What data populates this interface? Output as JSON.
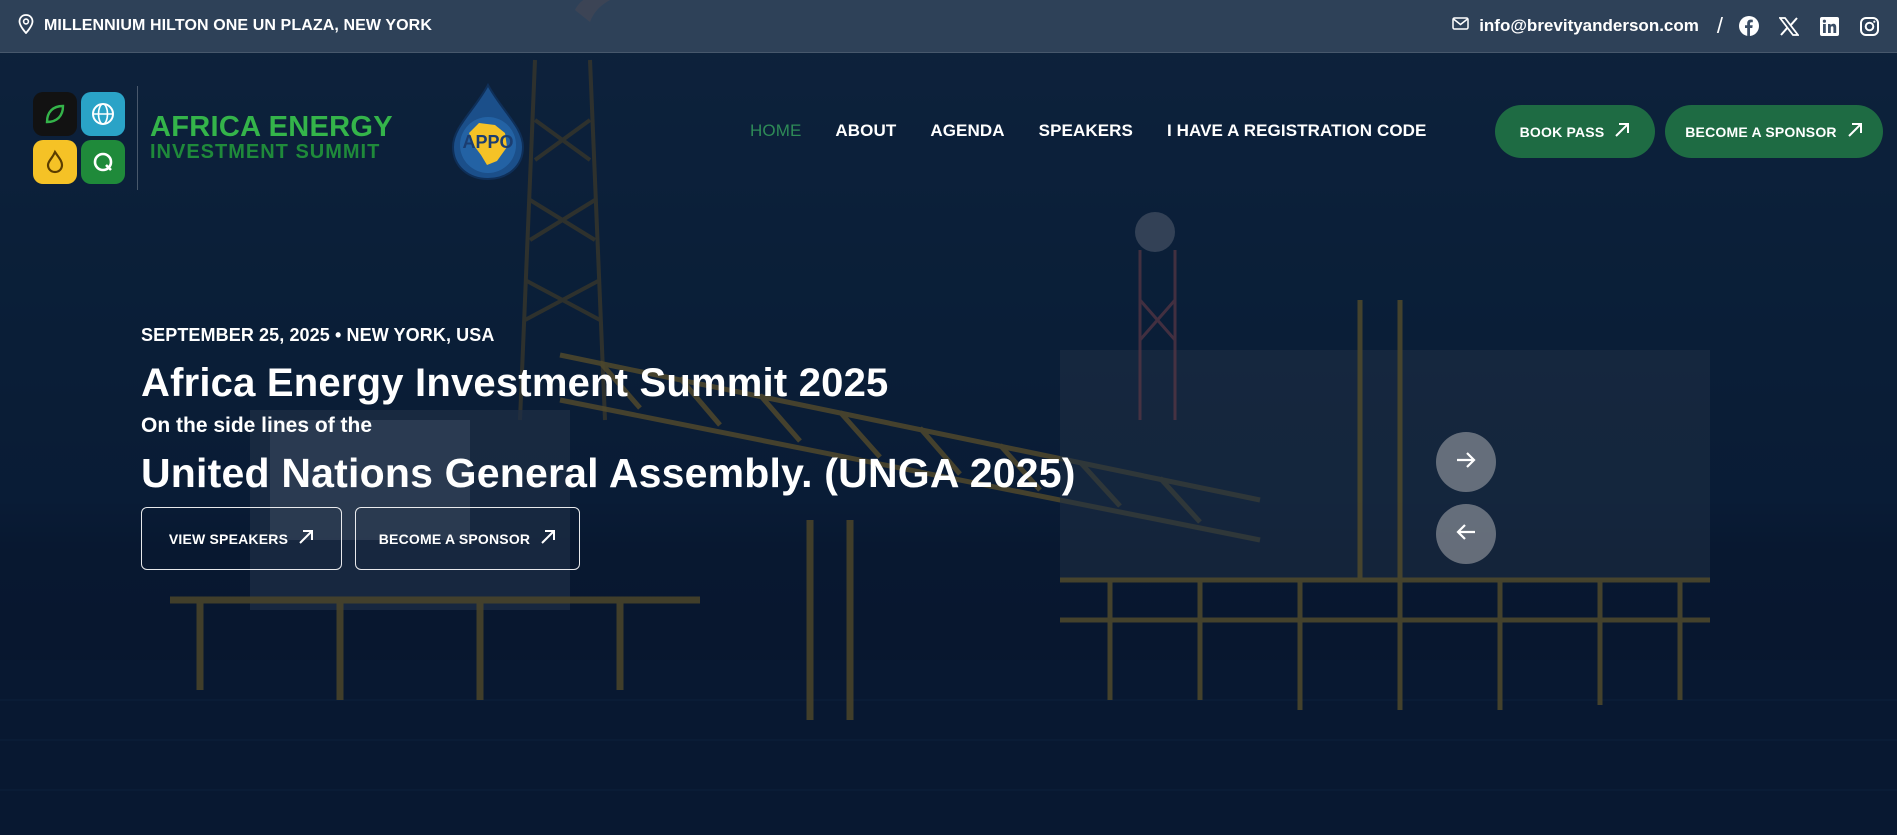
{
  "topbar": {
    "venue": "MILLENNIUM HILTON ONE UN PLAZA, NEW YORK",
    "email": "info@brevityanderson.com",
    "separator": "/",
    "social": [
      "facebook-icon",
      "x-icon",
      "linkedin-icon",
      "instagram-icon"
    ]
  },
  "logo": {
    "line1": "AFRICA ENERGY",
    "line2": "INVESTMENT SUMMIT",
    "partner_text": "APPO",
    "colors": {
      "green": "#34b44a",
      "darkgreen": "#1f8a3a",
      "teal": "#2aa3c7",
      "yellow": "#f5c226"
    }
  },
  "nav": {
    "items": [
      {
        "label": "HOME",
        "active": true
      },
      {
        "label": "ABOUT"
      },
      {
        "label": "AGENDA"
      },
      {
        "label": "SPEAKERS"
      },
      {
        "label": "I HAVE A REGISTRATION CODE"
      }
    ],
    "active_color": "#2e8b57"
  },
  "header_cta": {
    "book": "BOOK PASS",
    "sponsor": "BECOME A SPONSOR",
    "color": "#1e6b43"
  },
  "hero": {
    "eyebrow": "SEPTEMBER 25, 2025 • NEW YORK, USA",
    "title": "Africa Energy Investment Summit 2025",
    "subtitle": "On the side lines of the",
    "title2": "United Nations General Assembly. (UNGA 2025)",
    "btn_speakers": "VIEW SPEAKERS",
    "btn_sponsor": "BECOME A SPONSOR"
  },
  "slider": {
    "next": "arrow-right-icon",
    "prev": "arrow-left-icon"
  }
}
